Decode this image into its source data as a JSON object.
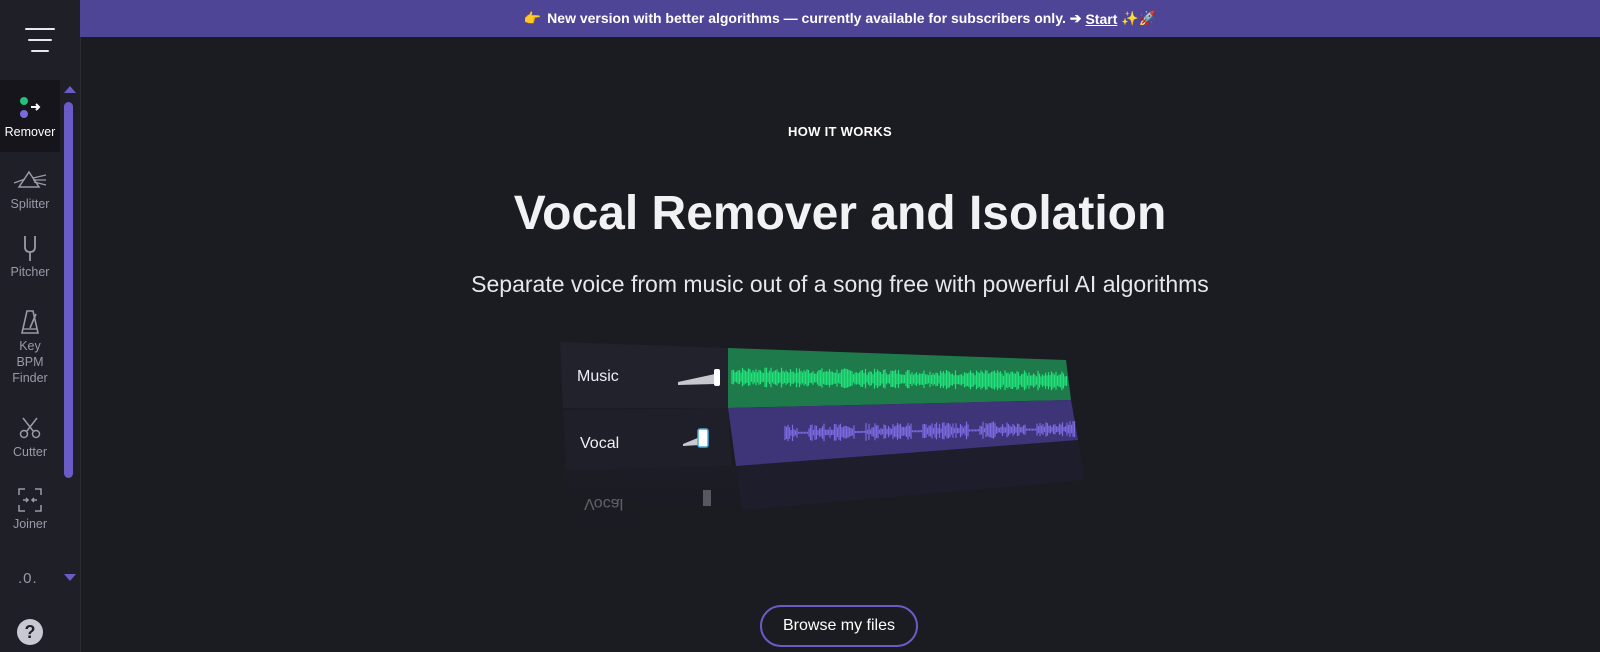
{
  "banner": {
    "lead_emoji": "👉",
    "text": "New version with better algorithms — currently available for subscribers only. ➔",
    "link": "Start",
    "trail_emoji": "✨🚀"
  },
  "sidebar": {
    "items": [
      {
        "label": "Remover",
        "icon": "remover-icon",
        "active": true
      },
      {
        "label": "Splitter",
        "icon": "prism-icon"
      },
      {
        "label": "Pitcher",
        "icon": "tuning-fork-icon"
      },
      {
        "label": "Key BPM Finder",
        "icon": "metronome-icon"
      },
      {
        "label": "Cutter",
        "icon": "scissors-icon"
      },
      {
        "label": "Joiner",
        "icon": "joiner-icon"
      }
    ],
    "partial_item_glyph": ".0.",
    "help_glyph": "?"
  },
  "main": {
    "eyebrow": "HOW IT WORKS",
    "title": "Vocal Remover and Isolation",
    "subtitle": "Separate voice from music out of a song free with powerful AI algorithms",
    "tracks": [
      {
        "label": "Music",
        "color": "#22e07a"
      },
      {
        "label": "Vocal",
        "color": "#7a6ae0"
      }
    ],
    "reflection_label": "Vocal",
    "browse_button": "Browse my files"
  },
  "colors": {
    "accent": "#6a5cc6",
    "banner_bg": "#4e4596",
    "page_bg": "#1b1b22",
    "music_wave": "#22e07a",
    "vocal_wave": "#7a6ae0"
  }
}
